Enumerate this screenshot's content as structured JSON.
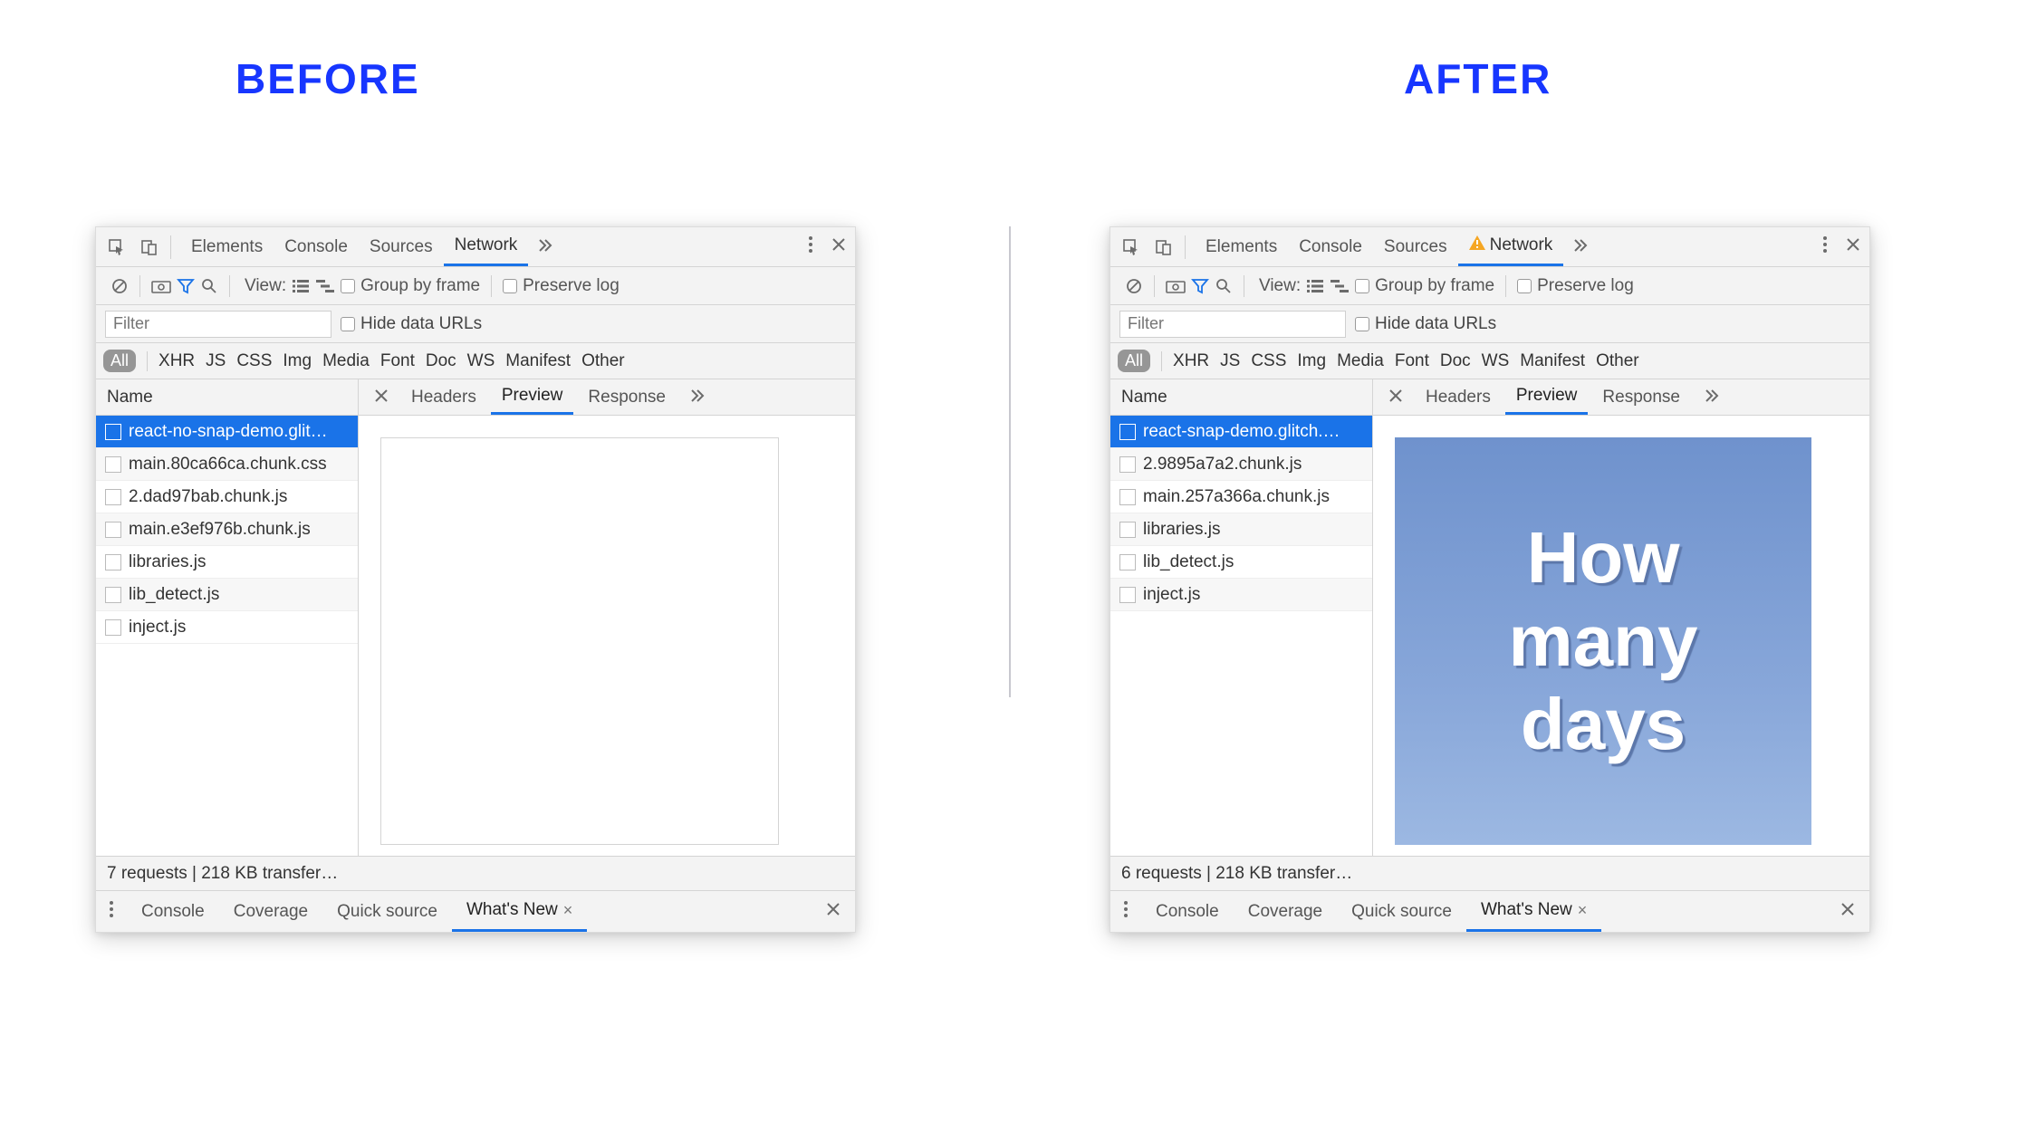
{
  "titles": {
    "before": "BEFORE",
    "after": "AFTER"
  },
  "topbar": {
    "tabs": [
      "Elements",
      "Console",
      "Sources",
      "Network"
    ],
    "active": "Network"
  },
  "toolbar": {
    "view_label": "View:",
    "group_by_frame": "Group by frame",
    "preserve_log": "Preserve log"
  },
  "filter": {
    "placeholder": "Filter",
    "hide_data_urls": "Hide data URLs"
  },
  "typeFilters": {
    "all": "All",
    "items": [
      "XHR",
      "JS",
      "CSS",
      "Img",
      "Media",
      "Font",
      "Doc",
      "WS",
      "Manifest",
      "Other"
    ]
  },
  "columns": {
    "name": "Name",
    "subtabs": [
      "Headers",
      "Preview",
      "Response"
    ],
    "active": "Preview"
  },
  "before": {
    "requests": [
      "react-no-snap-demo.glit…",
      "main.80ca66ca.chunk.css",
      "2.dad97bab.chunk.js",
      "main.e3ef976b.chunk.js",
      "libraries.js",
      "lib_detect.js",
      "inject.js"
    ],
    "status": "7 requests | 218 KB transfer…"
  },
  "after": {
    "requests": [
      "react-snap-demo.glitch.…",
      "2.9895a7a2.chunk.js",
      "main.257a366a.chunk.js",
      "libraries.js",
      "lib_detect.js",
      "inject.js"
    ],
    "status": "6 requests | 218 KB transfer…",
    "preview_lines": [
      "How",
      "many",
      "days"
    ]
  },
  "drawer": {
    "tabs": [
      "Console",
      "Coverage",
      "Quick source",
      "What's New"
    ],
    "active": "What's New"
  }
}
